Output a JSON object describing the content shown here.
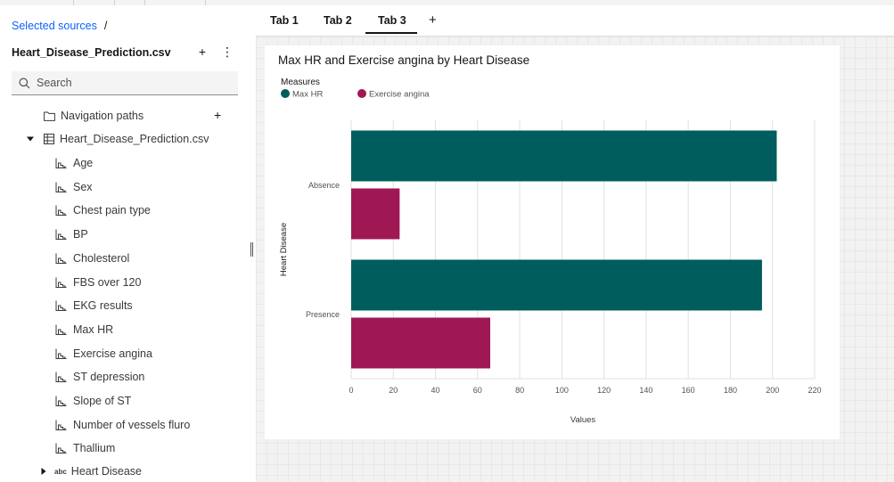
{
  "sidebar": {
    "breadcrumb_link": "Selected sources",
    "breadcrumb_sep": "/",
    "source_name": "Heart_Disease_Prediction.csv",
    "search_placeholder": "Search",
    "nav_paths": "Navigation paths",
    "file_node": "Heart_Disease_Prediction.csv",
    "columns": [
      "Age",
      "Sex",
      "Chest pain type",
      "BP",
      "Cholesterol",
      "FBS over 120",
      "EKG results",
      "Max HR",
      "Exercise angina",
      "ST depression",
      "Slope of ST",
      "Number of vessels fluro",
      "Thallium"
    ],
    "last_column": "Heart Disease",
    "last_column_type": "abc"
  },
  "tabs": [
    "Tab 1",
    "Tab 2",
    "Tab 3"
  ],
  "active_tab": "Tab 3",
  "add_tab": "+",
  "chart_data": {
    "type": "bar",
    "orientation": "horizontal",
    "title": "Max HR and Exercise angina by Heart Disease",
    "legend_title": "Measures",
    "legend_position": "top-left",
    "categories": [
      "Absence",
      "Presence"
    ],
    "series": [
      {
        "name": "Max HR",
        "color": "#005d5d",
        "values": [
          202,
          195
        ]
      },
      {
        "name": "Exercise angina",
        "color": "#9f1853",
        "values": [
          23,
          66
        ]
      }
    ],
    "xlabel": "Values",
    "ylabel": "Heart Disease",
    "xlim": [
      0,
      220
    ],
    "xticks": [
      0,
      20,
      40,
      60,
      80,
      100,
      120,
      140,
      160,
      180,
      200,
      220
    ],
    "grid": true
  }
}
